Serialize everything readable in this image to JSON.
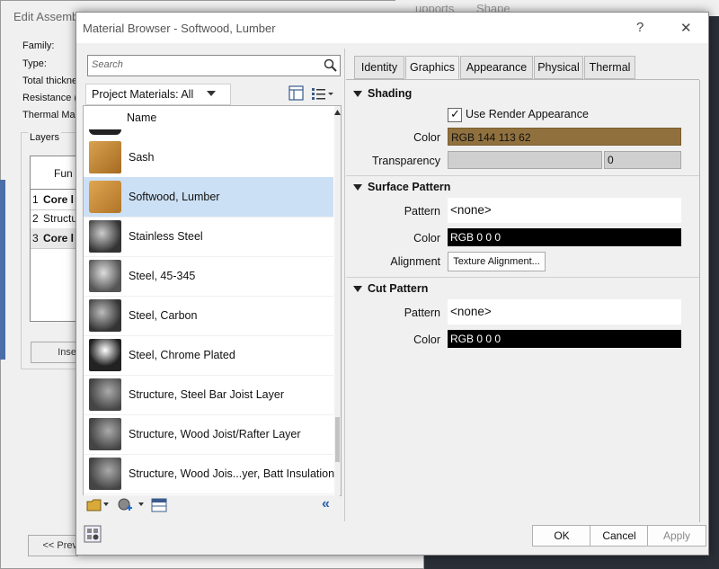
{
  "background_dialog": {
    "title": "Edit Assemb",
    "fields": [
      "Family:",
      "Type:",
      "Total thickne",
      "Resistance (",
      "Thermal Ma"
    ],
    "layers_label": "Layers",
    "grid_header": "Fun",
    "grid_rows": [
      {
        "num": "1",
        "text": "Core l"
      },
      {
        "num": "2",
        "text": "Structu"
      },
      {
        "num": "3",
        "text": "Core l"
      }
    ],
    "insert_button": "Inse",
    "prev_button": "<< Prev",
    "bg_tabs": [
      "upports",
      "Shape"
    ]
  },
  "dialog": {
    "title": "Material Browser - Softwood, Lumber",
    "help": "?",
    "close": "✕",
    "search_placeholder": "Search",
    "library_label": "Project Materials: All",
    "list_header": "Name",
    "materials": [
      {
        "name": "Sash",
        "thumb": "wood"
      },
      {
        "name": "Softwood, Lumber",
        "thumb": "wood-box"
      },
      {
        "name": "Stainless Steel",
        "thumb": "metal-cup"
      },
      {
        "name": "Steel, 45-345",
        "thumb": "metal-egg"
      },
      {
        "name": "Steel, Carbon",
        "thumb": "metal-cup"
      },
      {
        "name": "Steel, Chrome Plated",
        "thumb": "chrome"
      },
      {
        "name": "Structure, Steel Bar Joist Layer",
        "thumb": "sphere"
      },
      {
        "name": "Structure, Wood Joist/Rafter Layer",
        "thumb": "sphere"
      },
      {
        "name": "Structure, Wood Jois...yer, Batt Insulation",
        "thumb": "sphere"
      }
    ],
    "selected_material": "Softwood, Lumber",
    "tabs": [
      "Identity",
      "Graphics",
      "Appearance",
      "Physical",
      "Thermal"
    ],
    "active_tab": "Graphics",
    "shading": {
      "heading": "Shading",
      "use_render_label": "Use Render Appearance",
      "use_render_checked": true,
      "color_label": "Color",
      "color_value": "RGB 144 113 62",
      "color_hex": "#90713e",
      "transparency_label": "Transparency",
      "transparency_value": "0"
    },
    "surface_pattern": {
      "heading": "Surface Pattern",
      "pattern_label": "Pattern",
      "pattern_value": "<none>",
      "color_label": "Color",
      "color_value": "RGB 0 0 0",
      "alignment_label": "Alignment",
      "alignment_button": "Texture Alignment..."
    },
    "cut_pattern": {
      "heading": "Cut Pattern",
      "pattern_label": "Pattern",
      "pattern_value": "<none>",
      "color_label": "Color",
      "color_value": "RGB 0 0 0"
    },
    "buttons": {
      "ok": "OK",
      "cancel": "Cancel",
      "apply": "Apply"
    }
  }
}
